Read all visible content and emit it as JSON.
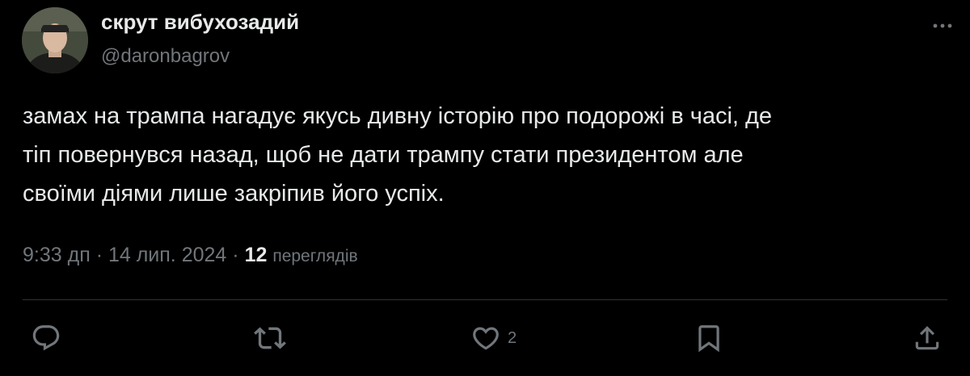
{
  "author": {
    "display_name": "скрут вибухозадий",
    "handle": "@daronbagrov"
  },
  "tweet": {
    "text_lines": [
      "замах на трампа нагадує якусь дивну історію про подорожі в часі, де",
      "тіп повернувся назад, щоб не дати трампу стати президентом але",
      "своїми діями лише закріпив його успіх."
    ]
  },
  "meta": {
    "time": "9:33 дп",
    "separator": "·",
    "date": "14 лип. 2024",
    "views_count": "12",
    "views_label": "переглядів"
  },
  "actions": {
    "likes_count": "2"
  },
  "icons": {
    "more": "more-horizontal-icon",
    "reply": "reply-icon",
    "retweet": "retweet-icon",
    "like": "heart-icon",
    "bookmark": "bookmark-icon",
    "share": "share-icon"
  },
  "colors": {
    "background": "#000000",
    "primary_text": "#e7e9ea",
    "secondary_text": "#71767b",
    "divider": "#2f3336"
  }
}
